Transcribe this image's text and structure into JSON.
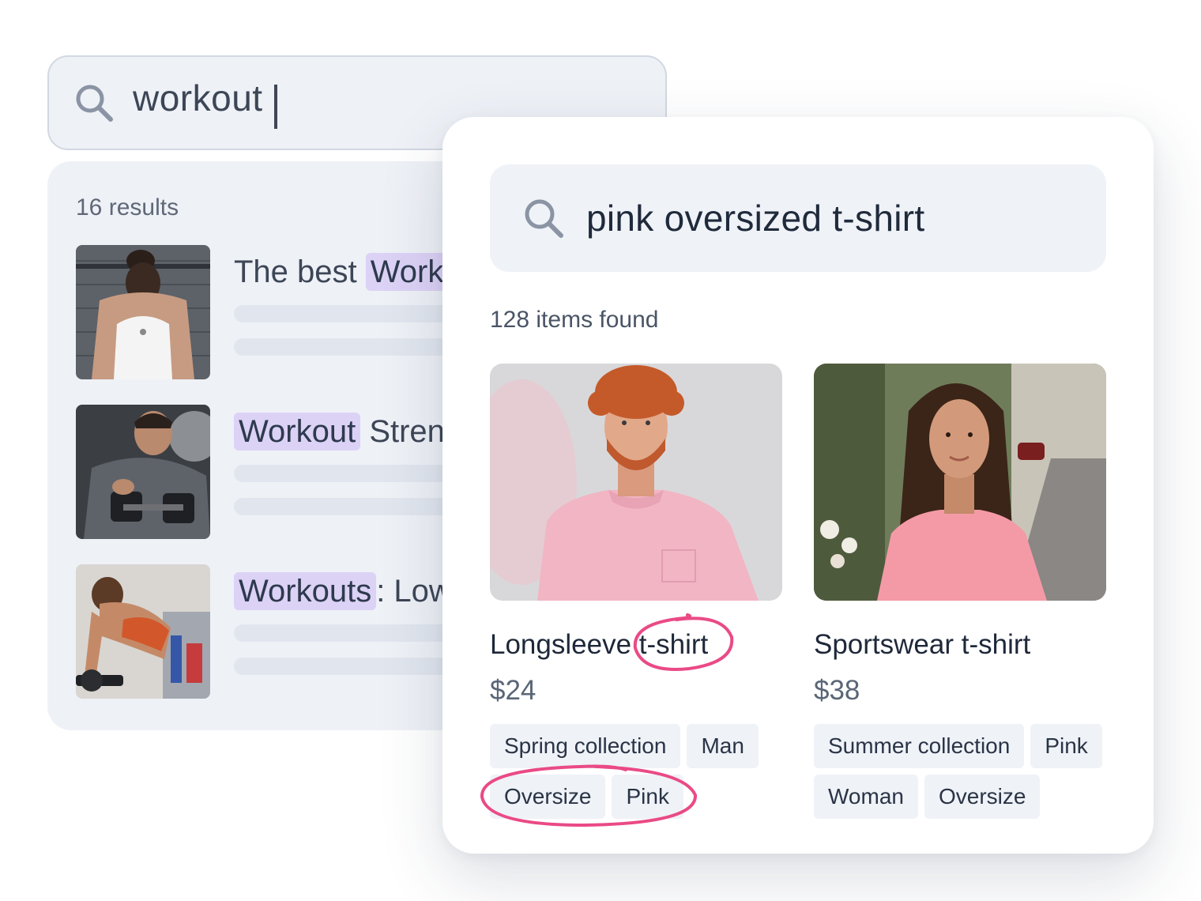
{
  "back_panel": {
    "search": {
      "query": "workout"
    },
    "results_count": "16 results",
    "results": [
      {
        "title_pre": "The best ",
        "title_highlight": "Work",
        "title_post": ""
      },
      {
        "title_pre": "",
        "title_highlight": "Workout",
        "title_post": " Streng"
      },
      {
        "title_pre": "",
        "title_highlight": "Workouts",
        "title_post": ": Low"
      }
    ]
  },
  "front_panel": {
    "search": {
      "query": "pink oversized t-shirt"
    },
    "items_found": "128 items found",
    "products": [
      {
        "name_pre": "Longsleeve ",
        "name_circled": "t-shirt",
        "price": "$24",
        "tags": [
          "Spring collection",
          "Man",
          "Oversize",
          "Pink"
        ]
      },
      {
        "name_pre": "Sportswear t-shirt",
        "name_circled": "",
        "price": "$38",
        "tags": [
          "Summer collection",
          "Pink",
          "Woman",
          "Oversize"
        ]
      }
    ]
  },
  "colors": {
    "highlight": "#dcd2f6",
    "annotation_ring": "#ea4a86",
    "panel_bg": "#eef1f6"
  }
}
